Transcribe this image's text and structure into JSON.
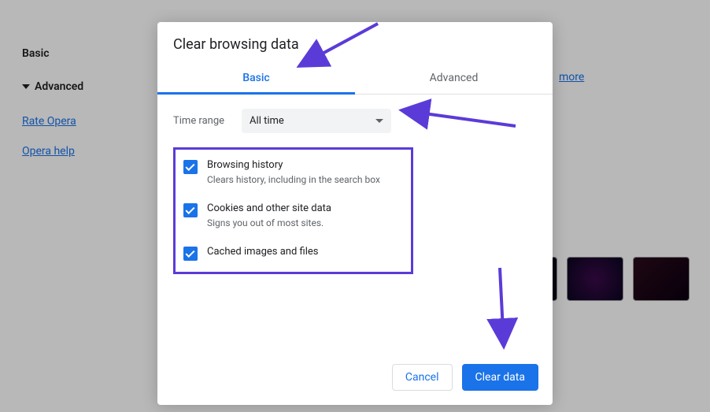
{
  "bg": {
    "sidebar": {
      "basic": "Basic",
      "advanced": "Advanced",
      "rate": "Rate Opera",
      "help": "Opera help"
    },
    "more": "more"
  },
  "dialog": {
    "title": "Clear browsing data",
    "tabs": {
      "basic": "Basic",
      "advanced": "Advanced"
    },
    "time_label": "Time range",
    "time_value": "All time",
    "options": [
      {
        "title": "Browsing history",
        "sub": "Clears history, including in the search box"
      },
      {
        "title": "Cookies and other site data",
        "sub": "Signs you out of most sites."
      },
      {
        "title": "Cached images and files",
        "sub": ""
      }
    ],
    "cancel": "Cancel",
    "clear": "Clear data"
  },
  "annotation_color": "#5b3bd8"
}
